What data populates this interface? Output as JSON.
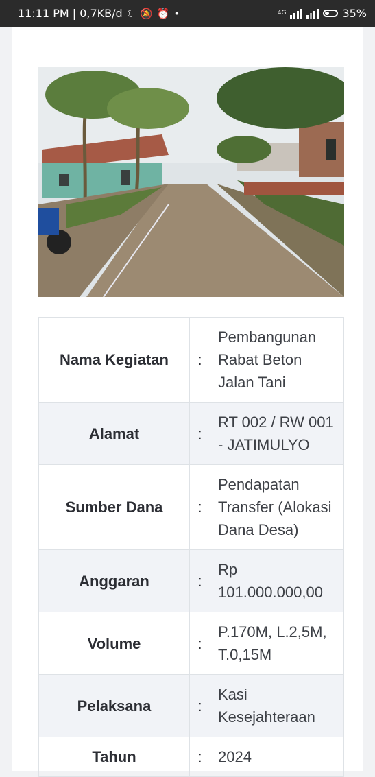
{
  "status_bar": {
    "time": "11:11 PM | 0,7KB/d",
    "network_label": "4G",
    "battery": "35%"
  },
  "photo": {
    "icon": "village-road-photo"
  },
  "info_table": {
    "separator": ":",
    "rows": [
      {
        "label": "Nama Kegiatan",
        "value": "Pembangunan Rabat Beton Jalan Tani"
      },
      {
        "label": "Alamat",
        "value": "RT 002 / RW 001 - JATIMULYO"
      },
      {
        "label": "Sumber Dana",
        "value": "Pendapatan Transfer (Alokasi Dana Desa)"
      },
      {
        "label": "Anggaran",
        "value": "Rp 101.000.000,00"
      },
      {
        "label": "Volume",
        "value": "P.170M, L.2,5M, T.0,15M"
      },
      {
        "label": "Pelaksana",
        "value": "Kasi Kesejahteraan"
      },
      {
        "label": "Tahun",
        "value": "2024"
      }
    ]
  }
}
